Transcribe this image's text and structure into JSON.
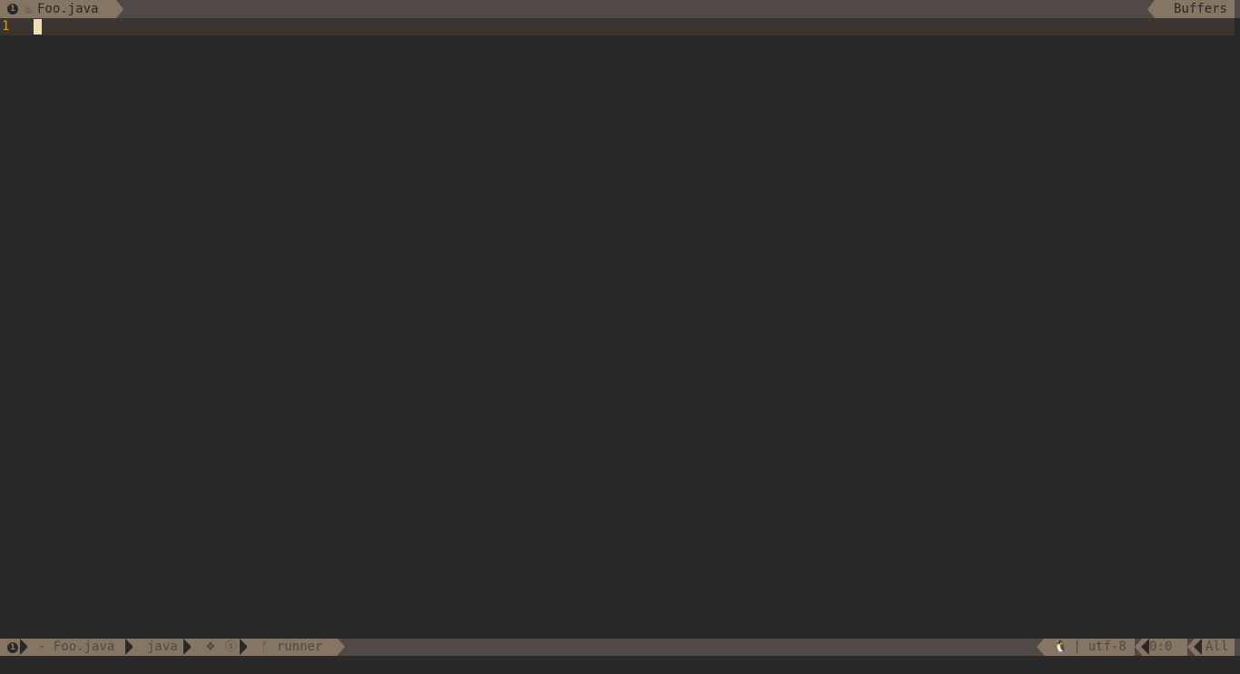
{
  "tabline": {
    "active_tab": {
      "index": "1",
      "filetype_icon": "java-icon",
      "filetype_glyph": "♨",
      "label": "Foo.java"
    },
    "buffers_label": "Buffers"
  },
  "editor": {
    "lines": [
      {
        "number": "1",
        "text": ""
      }
    ]
  },
  "statusline": {
    "window_number": "1",
    "file": "- Foo.java",
    "filetype": "java",
    "flags": "❖ ⓢ",
    "branch_icon": "ᚴ",
    "branch": "runner",
    "os_icon": "🐧",
    "os_separator": "|",
    "encoding": "utf-8",
    "position": "0:0",
    "scroll": "All"
  },
  "colors": {
    "background": "#292929",
    "bar": "#504945",
    "segment": "#857563",
    "line_number": "#d79921",
    "cursor": "#f2dfb0"
  }
}
